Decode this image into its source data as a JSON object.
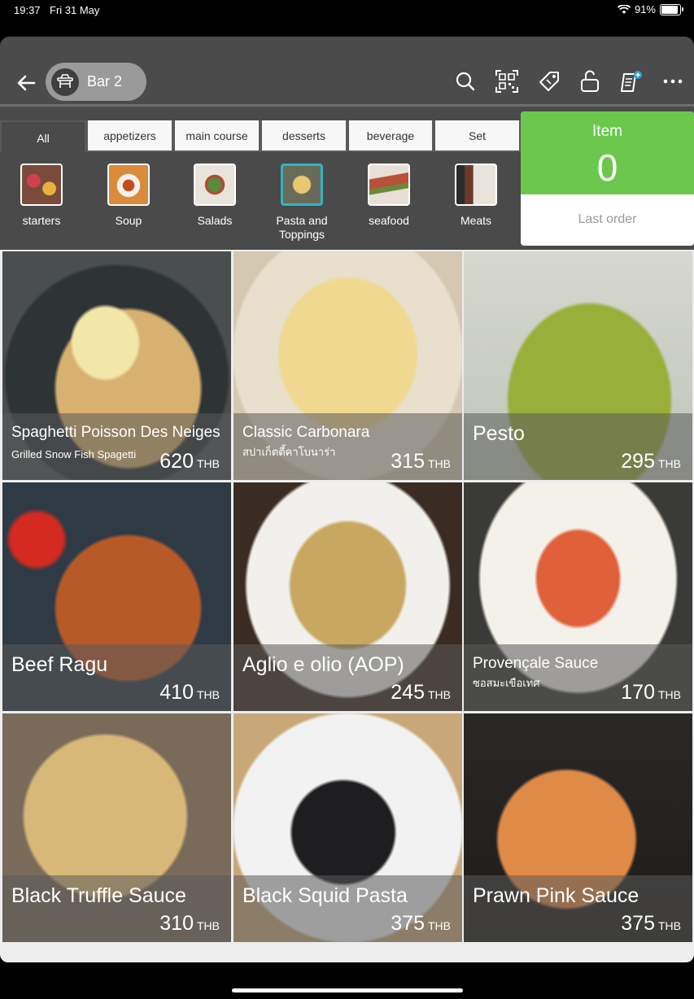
{
  "status": {
    "time": "19:37",
    "date": "Fri 31 May",
    "battery": "91%"
  },
  "header": {
    "table_label": "Bar 2"
  },
  "tabs": [
    {
      "label": "All",
      "active": true
    },
    {
      "label": "appetizers"
    },
    {
      "label": "main course"
    },
    {
      "label": "desserts"
    },
    {
      "label": "beverage"
    },
    {
      "label": "Set"
    }
  ],
  "categories": [
    {
      "label": "starters"
    },
    {
      "label": "Soup"
    },
    {
      "label": "Salads"
    },
    {
      "label": "Pasta and Toppings",
      "active": true
    },
    {
      "label": "seafood"
    },
    {
      "label": "Meats"
    }
  ],
  "order": {
    "item_label": "Item",
    "item_count": "0",
    "last_order_label": "Last order"
  },
  "menu_items": [
    {
      "name": "Spaghetti Poisson Des Neiges",
      "subtitle": "Grilled Snow Fish Spagetti",
      "price": "620",
      "currency": "THB"
    },
    {
      "name": "Classic Carbonara",
      "subtitle": "สปาเก็ตตี้คาโบนาร่า",
      "price": "315",
      "currency": "THB"
    },
    {
      "name": "Pesto",
      "subtitle": "",
      "price": "295",
      "currency": "THB"
    },
    {
      "name": "Beef Ragu",
      "subtitle": "",
      "price": "410",
      "currency": "THB"
    },
    {
      "name": "Aglio e olio (AOP)",
      "subtitle": "",
      "price": "245",
      "currency": "THB"
    },
    {
      "name": "Provençale Sauce",
      "subtitle": "ซอสมะเขือเทศ",
      "price": "170",
      "currency": "THB"
    },
    {
      "name": "Black Truffle Sauce",
      "subtitle": "",
      "price": "310",
      "currency": "THB"
    },
    {
      "name": "Black Squid Pasta",
      "subtitle": "",
      "price": "375",
      "currency": "THB"
    },
    {
      "name": "Prawn Pink Sauce",
      "subtitle": "",
      "price": "375",
      "currency": "THB"
    }
  ],
  "colors": {
    "accent_green": "#6bc84d",
    "active_category_border": "#2bb6c6"
  }
}
